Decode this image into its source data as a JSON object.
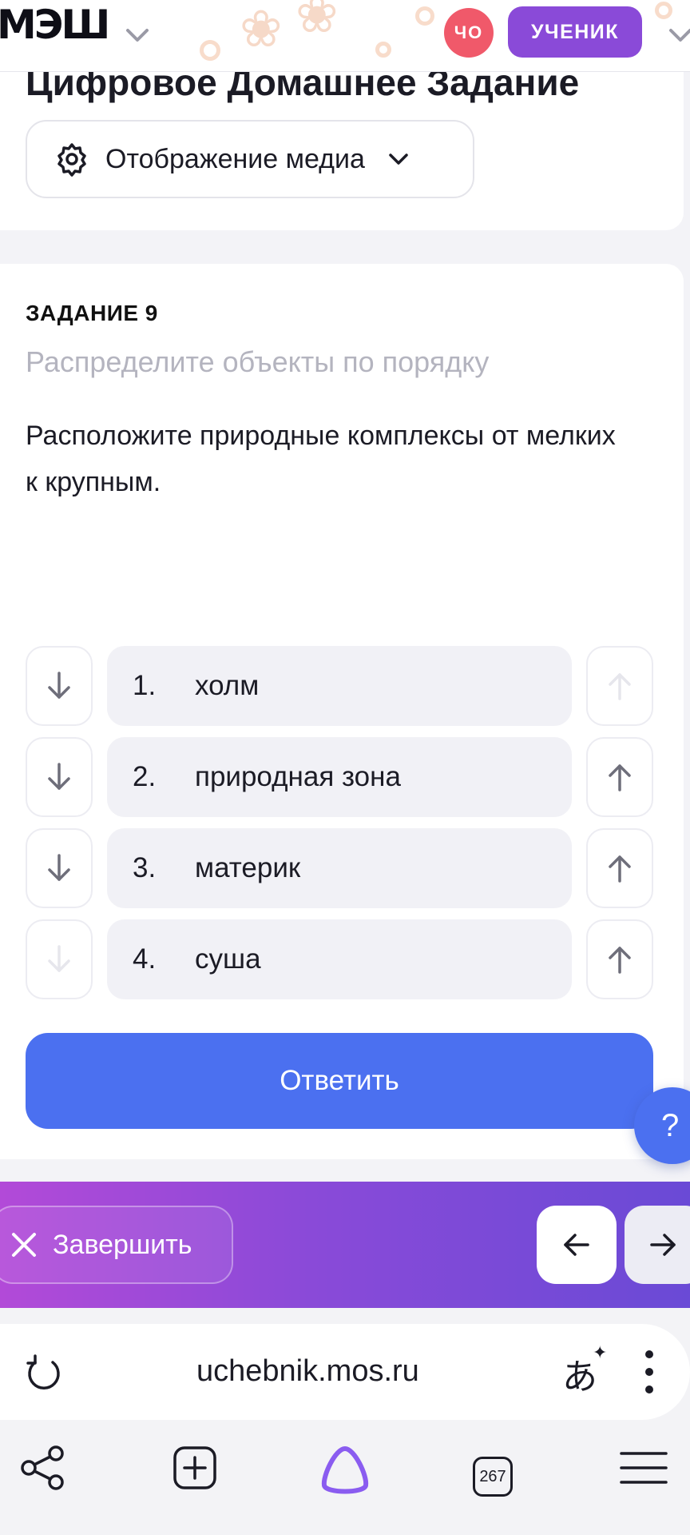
{
  "header": {
    "logo": "МЭШ",
    "avatar_initials": "ЧО",
    "role_label": "УЧЕНИК"
  },
  "page": {
    "title": "Цифровое Домашнее Задание",
    "media_dropdown_label": "Отображение медиа"
  },
  "task": {
    "number_label": "ЗАДАНИЕ 9",
    "type_label": "Распределите объекты по порядку",
    "text": "Расположите природные комплексы от мелких к крупным.",
    "items": [
      {
        "num": "1.",
        "label": "холм",
        "down_enabled": true,
        "up_enabled": false
      },
      {
        "num": "2.",
        "label": "природная зона",
        "down_enabled": true,
        "up_enabled": true
      },
      {
        "num": "3.",
        "label": "материк",
        "down_enabled": true,
        "up_enabled": true
      },
      {
        "num": "4.",
        "label": "суша",
        "down_enabled": false,
        "up_enabled": true
      }
    ],
    "answer_button": "Ответить",
    "help_label": "?"
  },
  "bottom_bar": {
    "finish_label": "Завершить"
  },
  "browser": {
    "url": "uchebnik.mos.ru",
    "tab_count": "267"
  },
  "colors": {
    "accent_blue": "#4b70f0",
    "purple": "#8a4ad8",
    "avatar_red": "#f0596a"
  }
}
